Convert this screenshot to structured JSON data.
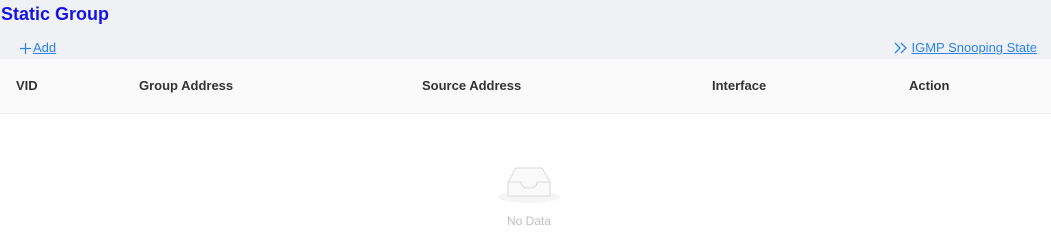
{
  "page": {
    "title": "Static Group"
  },
  "toolbar": {
    "add_label": "Add",
    "add_icon": "plus-icon",
    "snooping_label": " IGMP Snooping State",
    "snooping_icon": "double-chevron-right-icon"
  },
  "table": {
    "columns": [
      "VID",
      "Group Address",
      "Source Address",
      "Interface",
      "Action"
    ],
    "rows": [],
    "empty_text": "No Data",
    "empty_icon": "empty-inbox-icon"
  },
  "colors": {
    "title": "#1414e6",
    "link": "#2b84e8",
    "header_background": "#f0f1f5",
    "table_header_background": "#fafafa",
    "empty_text": "#bfbfbf"
  }
}
